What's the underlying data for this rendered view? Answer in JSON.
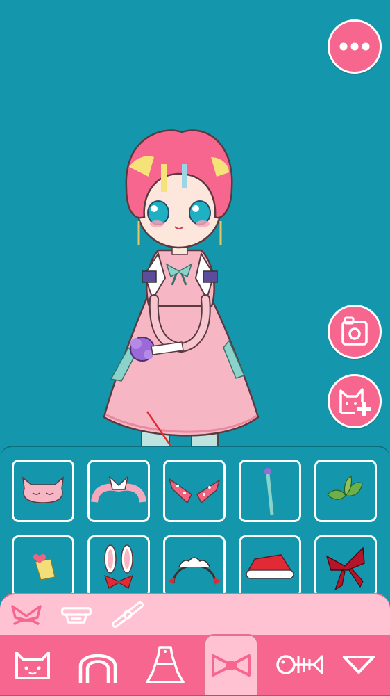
{
  "screen": {
    "title": "",
    "background_color": "#1497ac",
    "accent_color": "#f7668f",
    "subtab_color": "#ffc2d3"
  },
  "top_actions": [
    {
      "name": "more-options",
      "icon": "ellipsis-icon"
    },
    {
      "name": "camera",
      "icon": "camera-icon"
    },
    {
      "name": "add-character",
      "icon": "cat-plus-icon"
    }
  ],
  "items": [
    {
      "icon": "sleep-mask-cat-ears-icon"
    },
    {
      "icon": "pink-ribbon-bow-icon"
    },
    {
      "icon": "polka-dot-bandana-icon"
    },
    {
      "icon": "flower-hairpin-icon"
    },
    {
      "icon": "green-leaf-icon"
    },
    {
      "icon": "heart-hairclip-icon"
    },
    {
      "icon": "bunny-ears-bow-icon"
    },
    {
      "icon": "maid-headband-icon"
    },
    {
      "icon": "santa-hat-icon"
    },
    {
      "icon": "red-ribbon-bow-icon"
    }
  ],
  "subtabs": [
    {
      "icon": "headband-bow-icon",
      "active": true
    },
    {
      "icon": "hat-icon",
      "active": false
    },
    {
      "icon": "hairclip-icon",
      "active": false
    }
  ],
  "tabs": [
    {
      "icon": "cat-face-icon",
      "active": false
    },
    {
      "icon": "hair-icon",
      "active": false
    },
    {
      "icon": "dress-icon",
      "active": false
    },
    {
      "icon": "bow-icon",
      "active": true
    },
    {
      "icon": "fish-bone-icon",
      "active": false
    },
    {
      "icon": "more-triangle-icon",
      "active": false
    }
  ]
}
